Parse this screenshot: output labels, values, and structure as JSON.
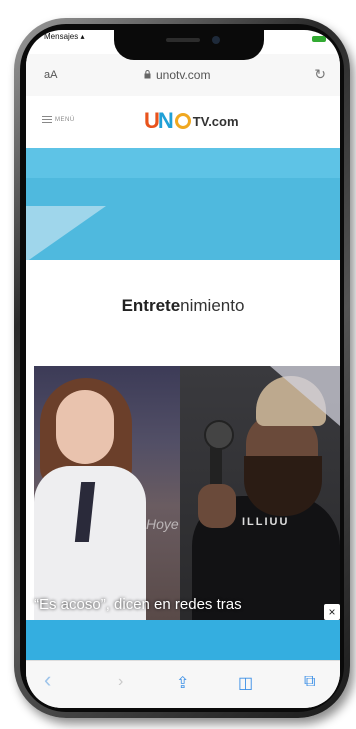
{
  "status": {
    "back_label": "Mensajes"
  },
  "browser": {
    "aa_label": "aA",
    "domain": "unotv.com",
    "reload_glyph": "↻"
  },
  "site": {
    "menu_label": "MENÚ",
    "logo_u": "U",
    "logo_n": "N",
    "logo_tv": "TV.com"
  },
  "section": {
    "title_bold": "Entrete",
    "title_light": "nimiento"
  },
  "article": {
    "photo_bg_text": "Hoye",
    "shirt_text": "ILLIUU",
    "headline": "“Es acoso”, dicen en redes tras"
  },
  "ad": {
    "close_glyph": "×"
  },
  "toolbar": {
    "back": "‹",
    "share": "⇪",
    "bookmarks": "◫",
    "tabs": "⧉"
  },
  "colors": {
    "accent_blue": "#4fb9de",
    "logo_orange": "#e8531c",
    "logo_blue": "#1fa0d6",
    "logo_yellow": "#f0a820"
  }
}
